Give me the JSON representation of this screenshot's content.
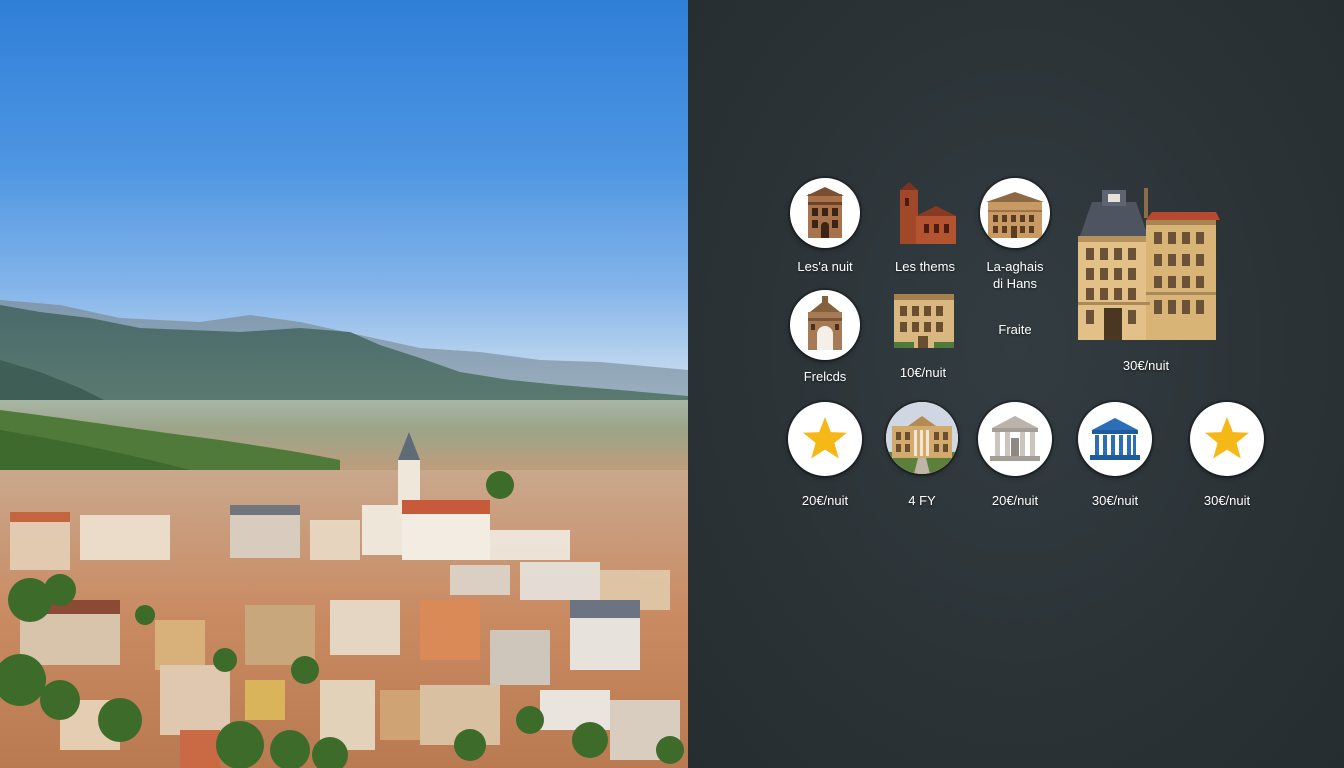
{
  "colors": {
    "panel_background": "#2a3236",
    "label_text": "#ffffff",
    "circle_fill": "#ffffff",
    "star_fill": "#f5b816",
    "temple_blue": "#2c6fb8"
  },
  "tiles": [
    {
      "label": "Les'a nuit",
      "icon": "building-facade-icon"
    },
    {
      "label": "Les thems",
      "icon": "church-tower-icon"
    },
    {
      "label": "La-aghais\ndi Hans",
      "icon": "palace-facade-icon"
    },
    {
      "label": "30€/nuit",
      "icon": "large-hotel-building-icon"
    },
    {
      "label": "Frelcds",
      "icon": "arch-gate-icon"
    },
    {
      "label": "10€/nuit",
      "icon": "townhouse-icon"
    },
    {
      "label": "Fraite",
      "icon": ""
    },
    {
      "label": "20€/nuit",
      "icon": "star-icon"
    },
    {
      "label": "4 FY",
      "icon": "palace-photo-icon"
    },
    {
      "label": "20€/nuit",
      "icon": "temple-icon"
    },
    {
      "label": "30€/nuit",
      "icon": "blue-temple-icon"
    },
    {
      "label": "30€/nuit",
      "icon": "star-icon"
    }
  ]
}
